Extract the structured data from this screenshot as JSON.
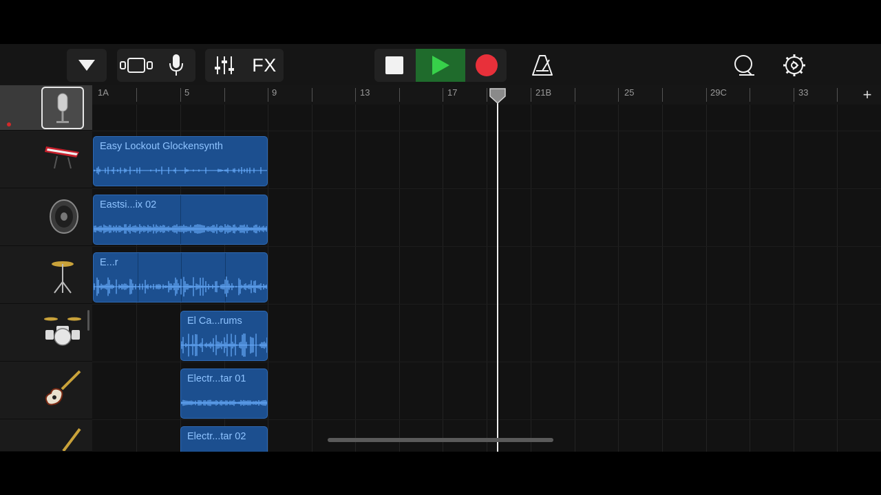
{
  "toolbar": {
    "fx_label": "FX",
    "icons": [
      "track-view-menu-icon",
      "browser-icon",
      "microphone-icon",
      "mixer-icon",
      "stop-icon",
      "play-icon",
      "record-icon",
      "metronome-icon",
      "loop-icon",
      "settings-icon"
    ],
    "play_active_color": "#1f6b2c",
    "record_color": "#e8303a",
    "play_color": "#37d14a"
  },
  "ruler": {
    "markers": [
      "1A",
      "5",
      "9",
      "13",
      "17",
      "21B",
      "25",
      "29C",
      "33"
    ],
    "add_label": "+"
  },
  "tracks": [
    {
      "instrument": "microphone-icon",
      "selected": true
    },
    {
      "instrument": "keyboard-synth-icon"
    },
    {
      "instrument": "speaker-icon"
    },
    {
      "instrument": "cymbal-icon"
    },
    {
      "instrument": "drum-kit-icon"
    },
    {
      "instrument": "electric-guitar-icon"
    },
    {
      "instrument": "guitar-icon"
    }
  ],
  "regions": [
    {
      "name": "Easy Lockout Glockensynth"
    },
    {
      "name": "Eastsi...ix 02"
    },
    {
      "name": "E...r"
    },
    {
      "name": "El Ca...rums"
    },
    {
      "name": "Electr...tar 01"
    },
    {
      "name": "Electr...tar 02"
    }
  ],
  "colors": {
    "region_fill": "#1c4f8f",
    "region_text": "#8ec3ff",
    "waveform": "#6aaeff"
  }
}
